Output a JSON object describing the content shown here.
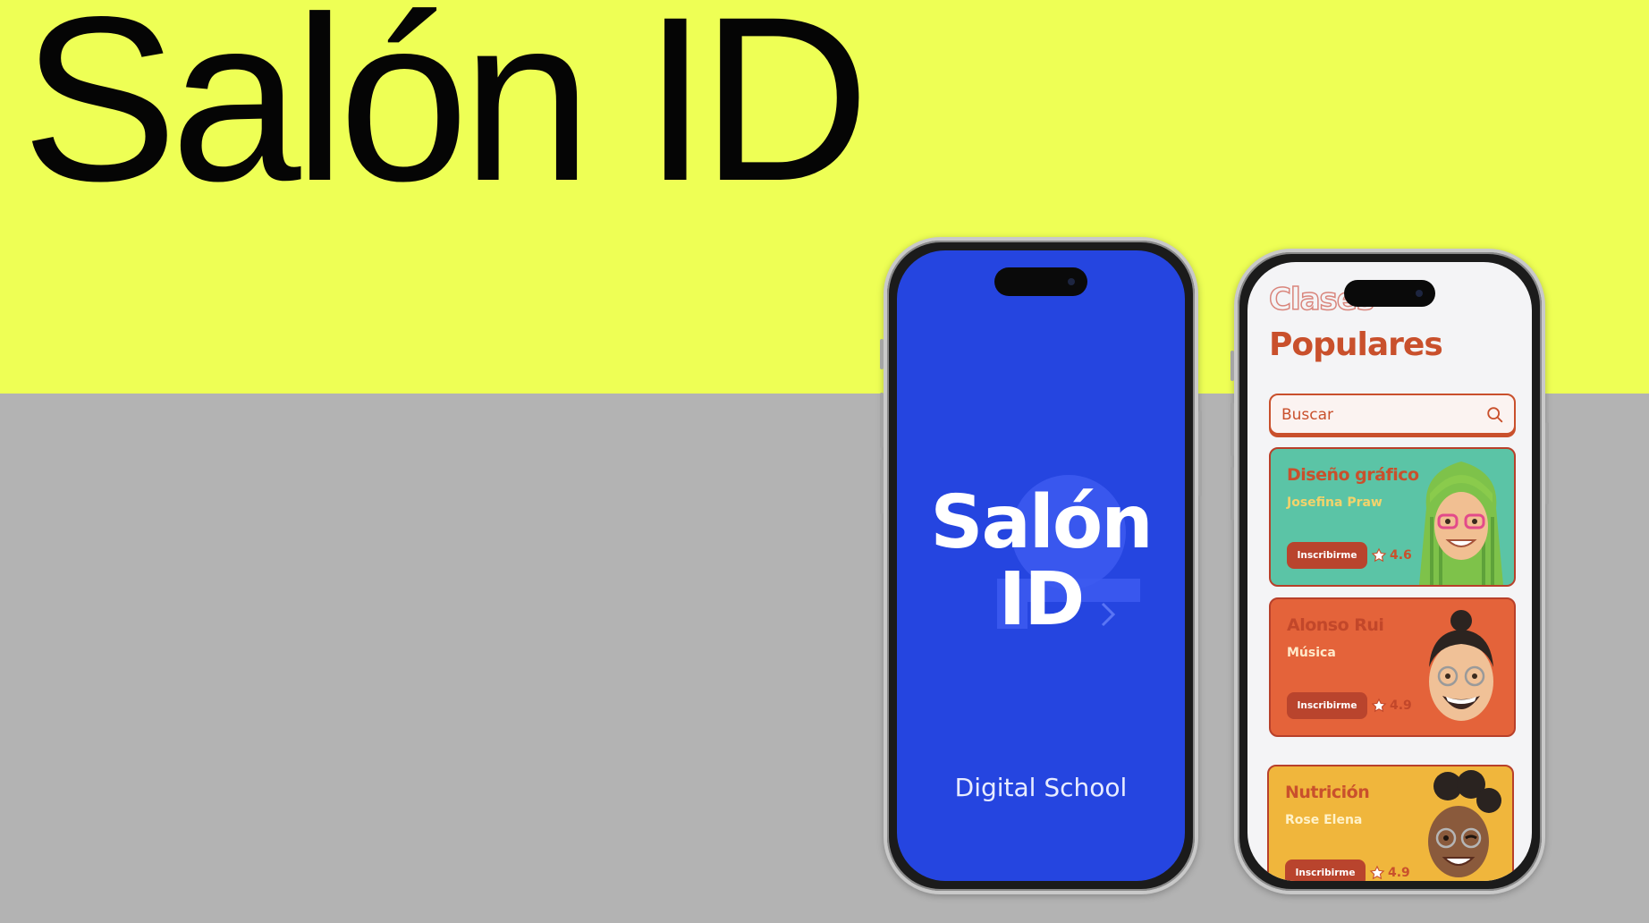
{
  "hero": {
    "title": "Salón ID"
  },
  "splash": {
    "title_line1": "Salón",
    "title_line2": "ID",
    "tagline": "Digital School"
  },
  "classes": {
    "outline_heading": "Clases",
    "heading": "Populares",
    "search": {
      "placeholder": "Buscar",
      "icon": "search-icon"
    },
    "cards": [
      {
        "title": "Diseño gráfico",
        "subtitle": "Josefina Praw",
        "button": "Inscribirme",
        "rating": "4.6",
        "color": "#5bc4a6"
      },
      {
        "title": "Alonso Rui",
        "subtitle": "Música",
        "button": "Inscribirme",
        "rating": "4.9",
        "color": "#e4633a"
      },
      {
        "title": "Nutrición",
        "subtitle": "Rose Elena",
        "button": "Inscribirme",
        "rating": "4.9",
        "color": "#f0b63c"
      }
    ]
  },
  "colors": {
    "accent_yellow": "#eeff55",
    "splash_blue": "#2545e0",
    "brand_orange": "#c9502c",
    "background_gray": "#b3b3b3"
  }
}
